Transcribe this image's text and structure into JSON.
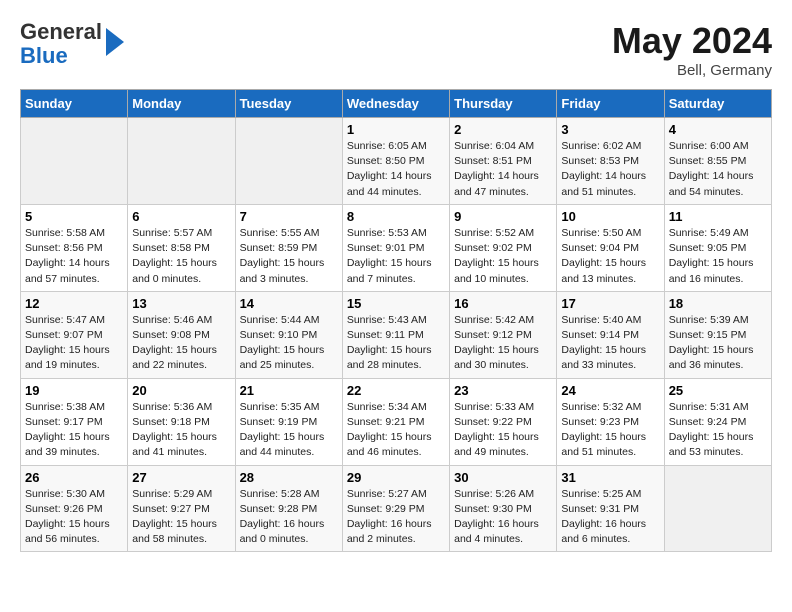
{
  "header": {
    "logo_line1": "General",
    "logo_line2": "Blue",
    "month_year": "May 2024",
    "location": "Bell, Germany"
  },
  "days_of_week": [
    "Sunday",
    "Monday",
    "Tuesday",
    "Wednesday",
    "Thursday",
    "Friday",
    "Saturday"
  ],
  "weeks": [
    [
      {
        "day": "",
        "empty": true
      },
      {
        "day": "",
        "empty": true
      },
      {
        "day": "",
        "empty": true
      },
      {
        "day": "1",
        "sunrise": "6:05 AM",
        "sunset": "8:50 PM",
        "daylight": "14 hours and 44 minutes."
      },
      {
        "day": "2",
        "sunrise": "6:04 AM",
        "sunset": "8:51 PM",
        "daylight": "14 hours and 47 minutes."
      },
      {
        "day": "3",
        "sunrise": "6:02 AM",
        "sunset": "8:53 PM",
        "daylight": "14 hours and 51 minutes."
      },
      {
        "day": "4",
        "sunrise": "6:00 AM",
        "sunset": "8:55 PM",
        "daylight": "14 hours and 54 minutes."
      }
    ],
    [
      {
        "day": "5",
        "sunrise": "5:58 AM",
        "sunset": "8:56 PM",
        "daylight": "14 hours and 57 minutes."
      },
      {
        "day": "6",
        "sunrise": "5:57 AM",
        "sunset": "8:58 PM",
        "daylight": "15 hours and 0 minutes."
      },
      {
        "day": "7",
        "sunrise": "5:55 AM",
        "sunset": "8:59 PM",
        "daylight": "15 hours and 3 minutes."
      },
      {
        "day": "8",
        "sunrise": "5:53 AM",
        "sunset": "9:01 PM",
        "daylight": "15 hours and 7 minutes."
      },
      {
        "day": "9",
        "sunrise": "5:52 AM",
        "sunset": "9:02 PM",
        "daylight": "15 hours and 10 minutes."
      },
      {
        "day": "10",
        "sunrise": "5:50 AM",
        "sunset": "9:04 PM",
        "daylight": "15 hours and 13 minutes."
      },
      {
        "day": "11",
        "sunrise": "5:49 AM",
        "sunset": "9:05 PM",
        "daylight": "15 hours and 16 minutes."
      }
    ],
    [
      {
        "day": "12",
        "sunrise": "5:47 AM",
        "sunset": "9:07 PM",
        "daylight": "15 hours and 19 minutes."
      },
      {
        "day": "13",
        "sunrise": "5:46 AM",
        "sunset": "9:08 PM",
        "daylight": "15 hours and 22 minutes."
      },
      {
        "day": "14",
        "sunrise": "5:44 AM",
        "sunset": "9:10 PM",
        "daylight": "15 hours and 25 minutes."
      },
      {
        "day": "15",
        "sunrise": "5:43 AM",
        "sunset": "9:11 PM",
        "daylight": "15 hours and 28 minutes."
      },
      {
        "day": "16",
        "sunrise": "5:42 AM",
        "sunset": "9:12 PM",
        "daylight": "15 hours and 30 minutes."
      },
      {
        "day": "17",
        "sunrise": "5:40 AM",
        "sunset": "9:14 PM",
        "daylight": "15 hours and 33 minutes."
      },
      {
        "day": "18",
        "sunrise": "5:39 AM",
        "sunset": "9:15 PM",
        "daylight": "15 hours and 36 minutes."
      }
    ],
    [
      {
        "day": "19",
        "sunrise": "5:38 AM",
        "sunset": "9:17 PM",
        "daylight": "15 hours and 39 minutes."
      },
      {
        "day": "20",
        "sunrise": "5:36 AM",
        "sunset": "9:18 PM",
        "daylight": "15 hours and 41 minutes."
      },
      {
        "day": "21",
        "sunrise": "5:35 AM",
        "sunset": "9:19 PM",
        "daylight": "15 hours and 44 minutes."
      },
      {
        "day": "22",
        "sunrise": "5:34 AM",
        "sunset": "9:21 PM",
        "daylight": "15 hours and 46 minutes."
      },
      {
        "day": "23",
        "sunrise": "5:33 AM",
        "sunset": "9:22 PM",
        "daylight": "15 hours and 49 minutes."
      },
      {
        "day": "24",
        "sunrise": "5:32 AM",
        "sunset": "9:23 PM",
        "daylight": "15 hours and 51 minutes."
      },
      {
        "day": "25",
        "sunrise": "5:31 AM",
        "sunset": "9:24 PM",
        "daylight": "15 hours and 53 minutes."
      }
    ],
    [
      {
        "day": "26",
        "sunrise": "5:30 AM",
        "sunset": "9:26 PM",
        "daylight": "15 hours and 56 minutes."
      },
      {
        "day": "27",
        "sunrise": "5:29 AM",
        "sunset": "9:27 PM",
        "daylight": "15 hours and 58 minutes."
      },
      {
        "day": "28",
        "sunrise": "5:28 AM",
        "sunset": "9:28 PM",
        "daylight": "16 hours and 0 minutes."
      },
      {
        "day": "29",
        "sunrise": "5:27 AM",
        "sunset": "9:29 PM",
        "daylight": "16 hours and 2 minutes."
      },
      {
        "day": "30",
        "sunrise": "5:26 AM",
        "sunset": "9:30 PM",
        "daylight": "16 hours and 4 minutes."
      },
      {
        "day": "31",
        "sunrise": "5:25 AM",
        "sunset": "9:31 PM",
        "daylight": "16 hours and 6 minutes."
      },
      {
        "day": "",
        "empty": true
      }
    ]
  ],
  "labels": {
    "sunrise": "Sunrise:",
    "sunset": "Sunset:",
    "daylight": "Daylight hours"
  }
}
